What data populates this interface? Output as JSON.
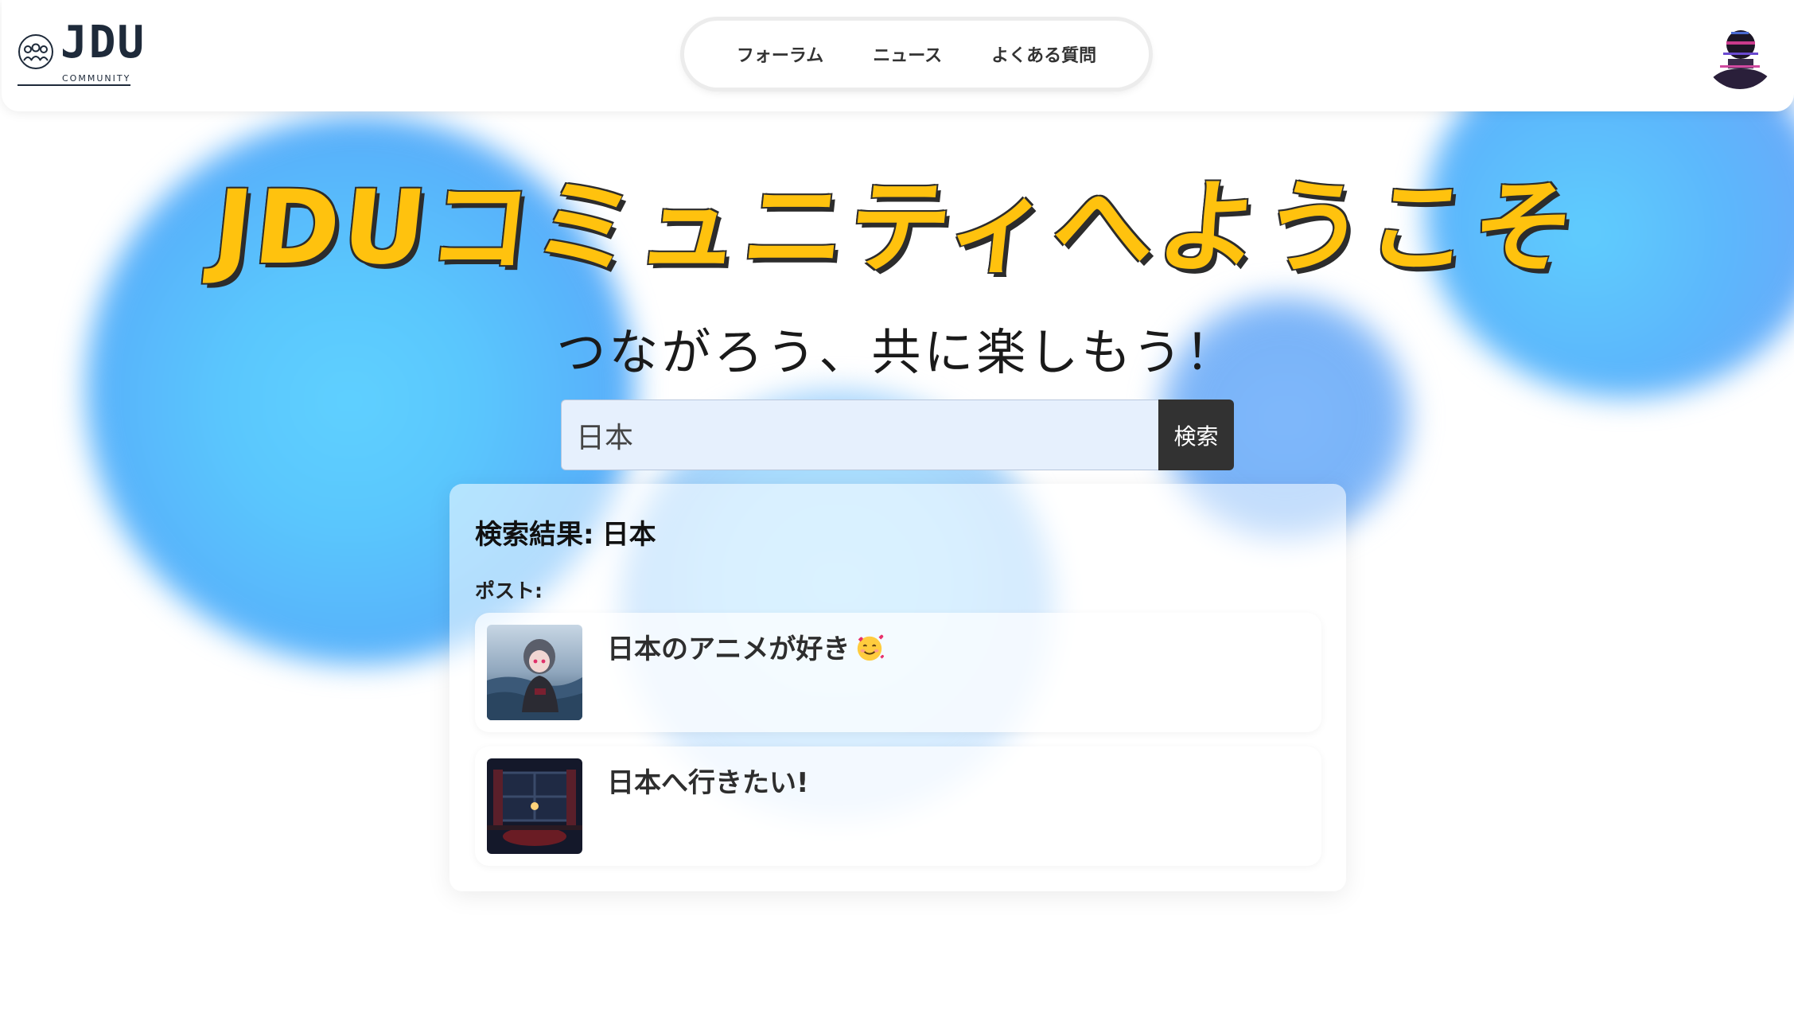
{
  "colors": {
    "accent": "#ffc20e",
    "button_dark": "#323232",
    "input_bg": "#e6f0fd",
    "blob_blue": "#5ac7fd"
  },
  "header": {
    "logo": {
      "text": "JDU",
      "sub": "COMMUNITY"
    },
    "nav": [
      {
        "label": "フォーラム"
      },
      {
        "label": "ニュース"
      },
      {
        "label": "よくある質問"
      }
    ],
    "avatar_icon": "user-avatar"
  },
  "hero": {
    "title": "JDUコミュニティへようこそ",
    "subtitle": "つながろう、共に楽しもう！"
  },
  "search": {
    "value": "日本",
    "button_label": "検索"
  },
  "results": {
    "heading_prefix": "検索結果:",
    "query": "日本",
    "section_label": "ポスト:",
    "posts": [
      {
        "title": "日本のアニメが好き",
        "emoji": "smiling-face-with-hearts"
      },
      {
        "title": "日本へ行きたい!"
      }
    ]
  }
}
